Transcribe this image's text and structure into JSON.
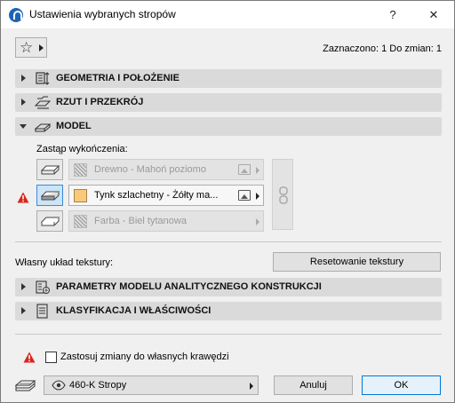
{
  "window": {
    "title": "Ustawienia wybranych stropów",
    "help_label": "?",
    "close_label": "✕"
  },
  "header": {
    "selection_info": "Zaznaczono: 1 Do zmian: 1"
  },
  "sections": {
    "geometry": "GEOMETRIA I POŁOŻENIE",
    "plan": "RZUT I PRZEKRÓJ",
    "model": "MODEL",
    "analytical": "PARAMETRY MODELU ANALITYCZNEGO KONSTRUKCJI",
    "classification": "KLASYFIKACJA I WŁAŚCIWOŚCI"
  },
  "model": {
    "override_label": "Zastąp wykończenia:",
    "surfaces": [
      {
        "name": "Drewno - Mahoń poziomo",
        "enabled": false
      },
      {
        "name": "Tynk szlachetny - Żółty ma...",
        "enabled": true
      },
      {
        "name": "Farba - Biel tytanowa",
        "enabled": false
      }
    ],
    "colors": {
      "warning": "#d9251d",
      "active_swatch": "#f9c97a",
      "active_border": "#3b8ad6"
    }
  },
  "texture": {
    "label": "Własny układ tekstury:",
    "reset_button": "Resetowanie tekstury"
  },
  "footer": {
    "apply_edges_label": "Zastosuj zmiany do własnych krawędzi",
    "apply_edges_checked": false,
    "layer_value": "460-K Stropy",
    "cancel_button": "Anuluj",
    "ok_button": "OK"
  }
}
